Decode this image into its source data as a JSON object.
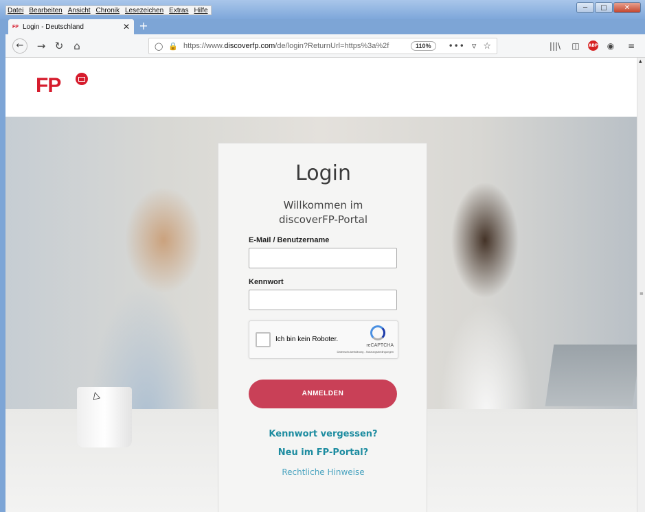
{
  "menu": [
    "Datei",
    "Bearbeiten",
    "Ansicht",
    "Chronik",
    "Lesezeichen",
    "Extras",
    "Hilfe"
  ],
  "tab": {
    "favicon": "FP",
    "title": "Login - Deutschland",
    "close": "✕",
    "new_tab": "+"
  },
  "nav": {
    "back": "←",
    "forward": "→",
    "reload": "↻",
    "home": "⌂",
    "url_prefix": "https://www.",
    "url_domain": "discoverfp.com",
    "url_rest": "/de/login?ReturnUrl=https%3a%2f",
    "zoom": "110%",
    "more": "•••",
    "pocket": "▿",
    "star": "☆"
  },
  "toolbar_icons": [
    "library-icon",
    "sidebar-icon",
    "adblock-icon",
    "account-icon",
    "menu-icon"
  ],
  "toolbar_glyphs": {
    "library": "|||\\",
    "sidebar": "◫",
    "abp": "ABP",
    "account": "◉",
    "menu": "≡"
  },
  "brand": {
    "logo_text": "FP",
    "color": "#d61c2d"
  },
  "login": {
    "title": "Login",
    "welcome_line1": "Willkommen im",
    "welcome_line2": "discoverFP-Portal",
    "email_label": "E-Mail / Benutzername",
    "password_label": "Kennwort",
    "captcha_text": "Ich bin kein Roboter.",
    "captcha_brand": "reCAPTCHA",
    "captcha_terms": "Datenschutzerklärung - Nutzungsbedingungen",
    "submit": "ANMELDEN",
    "forgot": "Kennwort vergessen?",
    "register": "Neu im FP-Portal?",
    "legal": "Rechtliche Hinweise",
    "accent": "#c94057",
    "link_color": "#1d8ca0"
  }
}
